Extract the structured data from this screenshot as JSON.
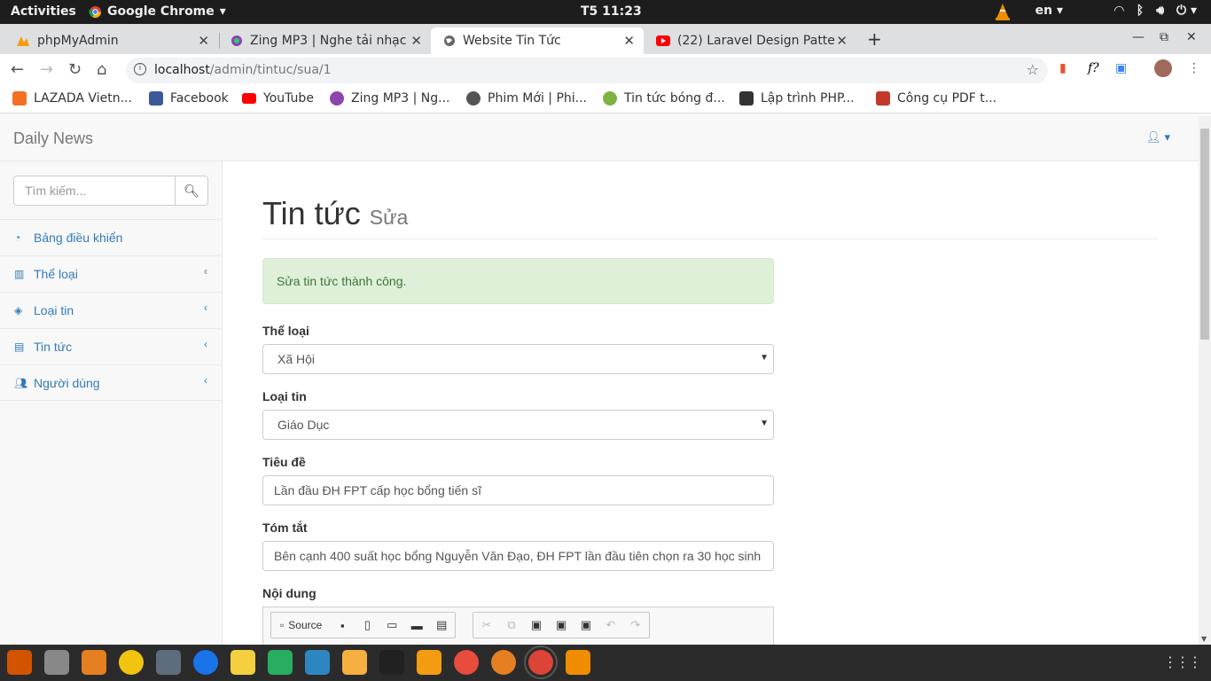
{
  "system": {
    "activities": "Activities",
    "app_name": "Google Chrome",
    "clock": "T5 11:23",
    "lang": "en"
  },
  "tabs": [
    {
      "title": "phpMyAdmin"
    },
    {
      "title": "Zing MP3 | Nghe tải nhạc"
    },
    {
      "title": "Website Tin Tức"
    },
    {
      "title": "(22) Laravel Design Patte"
    }
  ],
  "toolbar": {
    "url_host": "localhost",
    "url_path": "/admin/tintuc/sua/1"
  },
  "bookmarks": [
    {
      "label": "LAZADA Vietn...",
      "color": "#f36f21"
    },
    {
      "label": "Facebook",
      "color": "#3b5998"
    },
    {
      "label": "YouTube",
      "color": "#ff0000"
    },
    {
      "label": "Zing MP3 | Ng...",
      "color": "#8e44ad"
    },
    {
      "label": "Phim Mới | Phi...",
      "color": "#555555"
    },
    {
      "label": "Tin tức bóng đ...",
      "color": "#7cb342"
    },
    {
      "label": "Lập trình PHP...",
      "color": "#333333"
    },
    {
      "label": "Công cụ PDF t...",
      "color": "#c0392b"
    }
  ],
  "site": {
    "brand": "Daily News",
    "search_placeholder": "Tìm kiếm...",
    "menu": [
      {
        "label": "Bảng điều khiển",
        "icon": "dashboard-icon",
        "has_caret": false
      },
      {
        "label": "Thể loại",
        "icon": "bar-chart-icon",
        "has_caret": true
      },
      {
        "label": "Loại tin",
        "icon": "cube-icon",
        "has_caret": true
      },
      {
        "label": "Tin tức",
        "icon": "newspaper-icon",
        "has_caret": true
      },
      {
        "label": "Người dùng",
        "icon": "users-icon",
        "has_caret": true
      }
    ]
  },
  "form": {
    "title": "Tin tức",
    "subtitle": "Sửa",
    "alert": "Sửa tin tức thành công.",
    "category_label": "Thể loại",
    "category_value": "Xã Hội",
    "type_label": "Loại tin",
    "type_value": "Giáo Dục",
    "headline_label": "Tiêu đề",
    "headline_value": "Lần đầu ĐH FPT cấp học bổng tiến sĩ",
    "summary_label": "Tóm tắt",
    "summary_value": "Bên cạnh 400 suất học bổng Nguyễn Văn Đạo, ĐH FPT lần đầu tiên chọn ra 30 học sinh",
    "content_label": "Nội dung",
    "editor_source": "Source"
  },
  "colors": {
    "link": "#337ab7",
    "alert_bg": "#dff0d8",
    "alert_text": "#3c763d"
  }
}
